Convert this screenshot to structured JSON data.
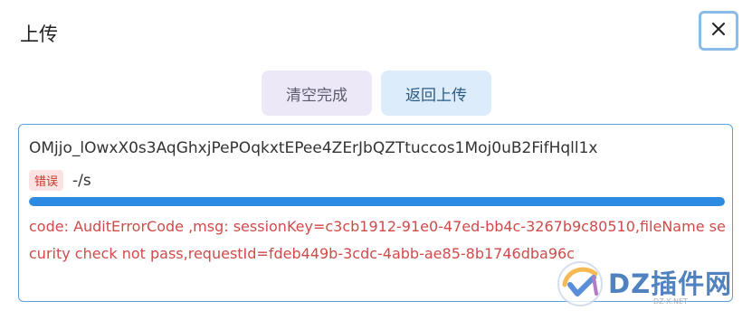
{
  "dialog": {
    "title": "上传",
    "close_icon": "close-icon"
  },
  "actions": {
    "clear_label": "清空完成",
    "back_label": "返回上传"
  },
  "upload_item": {
    "filename": "OMjjo_lOwxX0s3AqGhxjPePOqkxtEPee4ZErJbQZTtuccos1Moj0uB2FifHqll1x",
    "status_badge": "错误",
    "speed": "-/s",
    "progress": 1.0,
    "error_message": "code: AuditErrorCode ,msg: sessionKey=c3cb1912-91e0-47ed-bb4c-3267b9c80510,fileName security check not pass,requestId=fdeb449b-3cdc-4abb-ae85-8b1746dba96c"
  },
  "watermark": {
    "text": "DZ插件网",
    "sub": "DZ-X.NET"
  },
  "colors": {
    "progress": "#2d8ae2",
    "error": "#d14a4a",
    "border": "#5ba0dd"
  }
}
